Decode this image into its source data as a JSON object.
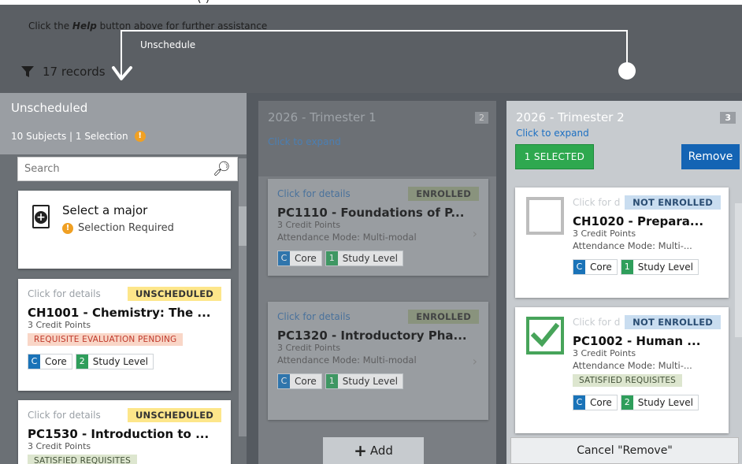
{
  "top_cut_text": "(                                )                                                ",
  "help": {
    "prefix": "Click the ",
    "bold": "Help",
    "suffix": " button above for further assistance"
  },
  "records": {
    "count_label": "17 records"
  },
  "drag_tip": "Unschedule",
  "unscheduled": {
    "title": "Unscheduled",
    "subtitle": "10 Subjects | 1 Selection",
    "search_placeholder": "Search",
    "major_card": {
      "title": "Select a major",
      "status": "Selection Required"
    },
    "cards": [
      {
        "details": "Click for details",
        "badge": "UNSCHEDULED",
        "code": "CH1001 - Chemistry: The ...",
        "credits": "3 Credit Points",
        "req": "REQUISITE EVALUATION PENDING",
        "tag1_letter": "C",
        "tag1": "Core",
        "tag2_num": "2",
        "tag2": "Study Level"
      },
      {
        "details": "Click for details",
        "badge": "UNSCHEDULED",
        "code": "PC1530 - Introduction to ...",
        "credits": "3 Credit Points",
        "req": "SATISFIED REQUISITES"
      }
    ]
  },
  "trimester1": {
    "title": "2026 - Trimester 1",
    "count": "2",
    "expand": "Click to expand",
    "add_label": "Add",
    "cards": [
      {
        "details": "Click for details",
        "badge": "ENROLLED",
        "code": "PC1110 - Foundations of P...",
        "credits": "3 Credit Points",
        "attendance": "Attendance Mode: Multi-modal",
        "tag1_letter": "C",
        "tag1": "Core",
        "tag2_num": "1",
        "tag2": "Study Level"
      },
      {
        "details": "Click for details",
        "badge": "ENROLLED",
        "code": "PC1320 - Introductory Pha...",
        "credits": "3 Credit Points",
        "attendance": "Attendance Mode: Multi-modal",
        "tag1_letter": "C",
        "tag1": "Core",
        "tag2_num": "1",
        "tag2": "Study Level"
      }
    ]
  },
  "trimester2": {
    "title": "2026 - Trimester 2",
    "count": "3",
    "expand": "Click to expand",
    "selected_label": "1 SELECTED",
    "remove_label": "Remove",
    "cancel_label": "Cancel \"Remove\"",
    "cards": [
      {
        "details": "Click for d",
        "badge": "NOT ENROLLED",
        "code": "CH1020 - Prepara...",
        "credits": "3 Credit Points",
        "attendance": "Attendance Mode: Multi-...",
        "tag1_letter": "C",
        "tag1": "Core",
        "tag2_num": "1",
        "tag2": "Study Level",
        "checked": false
      },
      {
        "details": "Click for d",
        "badge": "NOT ENROLLED",
        "code": "PC1002 - Human ...",
        "credits": "3 Credit Points",
        "attendance": "Attendance Mode: Multi-...",
        "req": "SATISFIED REQUISITES",
        "tag1_letter": "C",
        "tag1": "Core",
        "tag2_num": "2",
        "tag2": "Study Level",
        "checked": true
      }
    ]
  },
  "icons": {
    "filter": "filter-icon",
    "search": "search-icon",
    "warning": "warning-icon",
    "document": "add-document-icon",
    "check": "check-icon",
    "chevron": "chevron-right-icon"
  }
}
